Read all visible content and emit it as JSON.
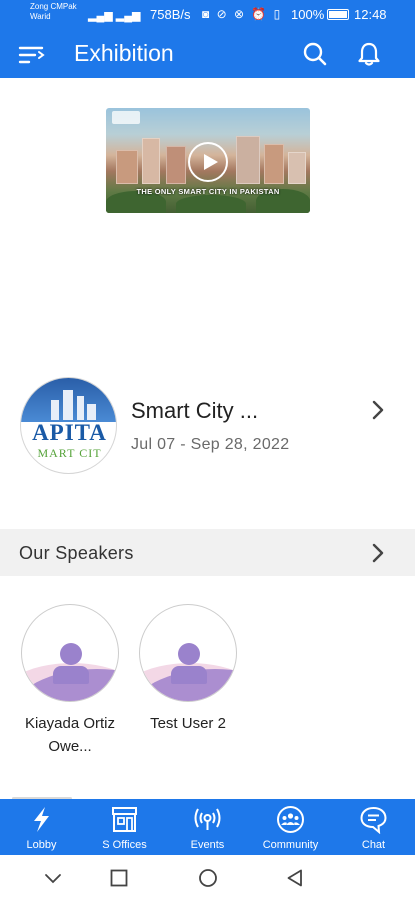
{
  "status_bar": {
    "carrier": "Zong CMPak Warid",
    "net_speed": "758B/s",
    "battery": "100%",
    "time": "12:48"
  },
  "app_bar": {
    "title": "Exhibition"
  },
  "video": {
    "caption": "THE ONLY SMART CITY IN PAKISTAN"
  },
  "event": {
    "logo_text_line1": "APITA",
    "logo_text_line2": "MART CIT",
    "name": "Smart City ...",
    "dates": "Jul 07 - Sep 28, 2022"
  },
  "speakers": {
    "header": "Our Speakers",
    "items": [
      {
        "name": "Kiayada Ortiz Owe..."
      },
      {
        "name": "Test User 2"
      }
    ]
  },
  "bottom_nav": {
    "items": [
      {
        "label": "Lobby",
        "icon": "lightning-icon"
      },
      {
        "label": "S Offices",
        "icon": "storefront-icon"
      },
      {
        "label": "Events",
        "icon": "broadcast-icon"
      },
      {
        "label": "Community",
        "icon": "community-icon"
      },
      {
        "label": "Chat",
        "icon": "chat-bubble-icon"
      }
    ]
  },
  "theme": {
    "primary": "#1e78ea",
    "section_bg": "#f1f1f1",
    "avatar_accent": "#ab8ed0"
  }
}
